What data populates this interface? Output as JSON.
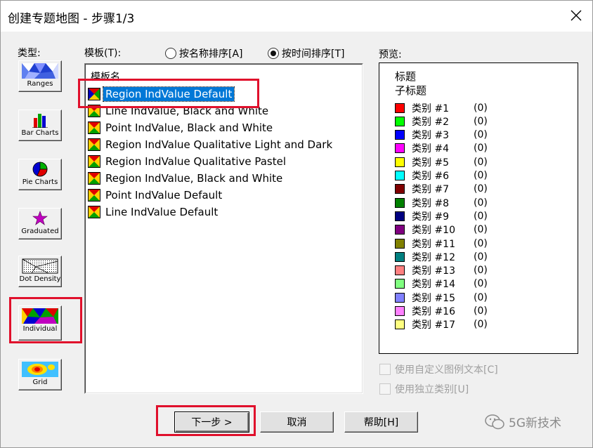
{
  "window": {
    "title": "创建专题地图 - 步骤1/3"
  },
  "labels": {
    "type": "类型:",
    "template": "模板(T):",
    "preview": "预览:"
  },
  "sort": {
    "by_name": "按名称排序[A]",
    "by_time": "按时间排序[T]",
    "selected": "by_time"
  },
  "types": [
    {
      "label": "Ranges",
      "icon": "ranges-map-icon"
    },
    {
      "label": "Bar Charts",
      "icon": "bar-chart-icon"
    },
    {
      "label": "Pie Charts",
      "icon": "pie-chart-icon"
    },
    {
      "label": "Graduated",
      "icon": "star-icon"
    },
    {
      "label": "Dot Density",
      "icon": "dot-density-icon"
    },
    {
      "label": "Individual",
      "icon": "individual-map-icon",
      "selected": true
    },
    {
      "label": "Grid",
      "icon": "grid-heatmap-icon"
    }
  ],
  "templates": {
    "header": "模板名",
    "items": [
      "Region IndValue Default",
      "Line IndValue, Black and White",
      "Point IndValue, Black and White",
      "Region IndValue Qualitative Light and Dark",
      "Region IndValue Qualitative Pastel",
      "Region IndValue, Black and White",
      "Point IndValue Default",
      "Line IndValue Default"
    ],
    "selected_index": 0
  },
  "preview": {
    "title": "标题",
    "subtitle": "子标题",
    "legend": [
      {
        "name": "类别 #1",
        "count": "(0)",
        "color": "#ff0000"
      },
      {
        "name": "类别 #2",
        "count": "(0)",
        "color": "#00ff00"
      },
      {
        "name": "类别 #3",
        "count": "(0)",
        "color": "#0000ff"
      },
      {
        "name": "类别 #4",
        "count": "(0)",
        "color": "#ff00ff"
      },
      {
        "name": "类别 #5",
        "count": "(0)",
        "color": "#ffff00"
      },
      {
        "name": "类别 #6",
        "count": "(0)",
        "color": "#00ffff"
      },
      {
        "name": "类别 #7",
        "count": "(0)",
        "color": "#800000"
      },
      {
        "name": "类别 #8",
        "count": "(0)",
        "color": "#008000"
      },
      {
        "name": "类别 #9",
        "count": "(0)",
        "color": "#000080"
      },
      {
        "name": "类别 #10",
        "count": "(0)",
        "color": "#800080"
      },
      {
        "name": "类别 #11",
        "count": "(0)",
        "color": "#808000"
      },
      {
        "name": "类别 #12",
        "count": "(0)",
        "color": "#008080"
      },
      {
        "name": "类别 #13",
        "count": "(0)",
        "color": "#ff8080"
      },
      {
        "name": "类别 #14",
        "count": "(0)",
        "color": "#80ff80"
      },
      {
        "name": "类别 #15",
        "count": "(0)",
        "color": "#8080ff"
      },
      {
        "name": "类别 #16",
        "count": "(0)",
        "color": "#ff80ff"
      },
      {
        "name": "类别 #17",
        "count": "(0)",
        "color": "#ffff80"
      }
    ]
  },
  "options": {
    "custom_legend_text": "使用自定义图例文本[C]",
    "independent_category": "使用独立类别[U]"
  },
  "buttons": {
    "next": "下一步 >",
    "cancel": "取消",
    "help": "帮助[H]"
  },
  "watermark": "5G新技术",
  "highlight_color": "#e0102c"
}
